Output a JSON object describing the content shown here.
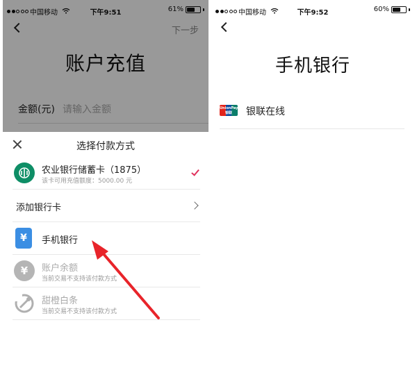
{
  "left": {
    "statusbar": {
      "carrier": "中国移动",
      "time": "下午9:51",
      "battery": "61%",
      "battery_level": 0.61
    },
    "nav": {
      "next_label": "下一步"
    },
    "page_title": "账户充值",
    "amount": {
      "label": "金额(元)",
      "placeholder": "请输入金额"
    },
    "sheet": {
      "title": "选择付款方式",
      "bank_card": {
        "name": "农业银行储蓄卡（1875）",
        "sub": "该卡可用充值额度：5000.00 元",
        "selected": true
      },
      "add_card_label": "添加银行卡",
      "mobile_bank": {
        "name": "手机银行"
      },
      "balance": {
        "name": "账户余额",
        "sub": "当前交易不支持该付款方式"
      },
      "baitiao": {
        "name": "甜橙白条",
        "sub": "当前交易不支持该付款方式"
      }
    },
    "arrow_color": "#e8242a"
  },
  "right": {
    "statusbar": {
      "carrier": "中国移动",
      "time": "下午9:52",
      "battery": "60%",
      "battery_level": 0.6
    },
    "page_title": "手机银行",
    "options": [
      {
        "label": "银联在线",
        "logo_text": "UnionPay 银联"
      }
    ]
  }
}
